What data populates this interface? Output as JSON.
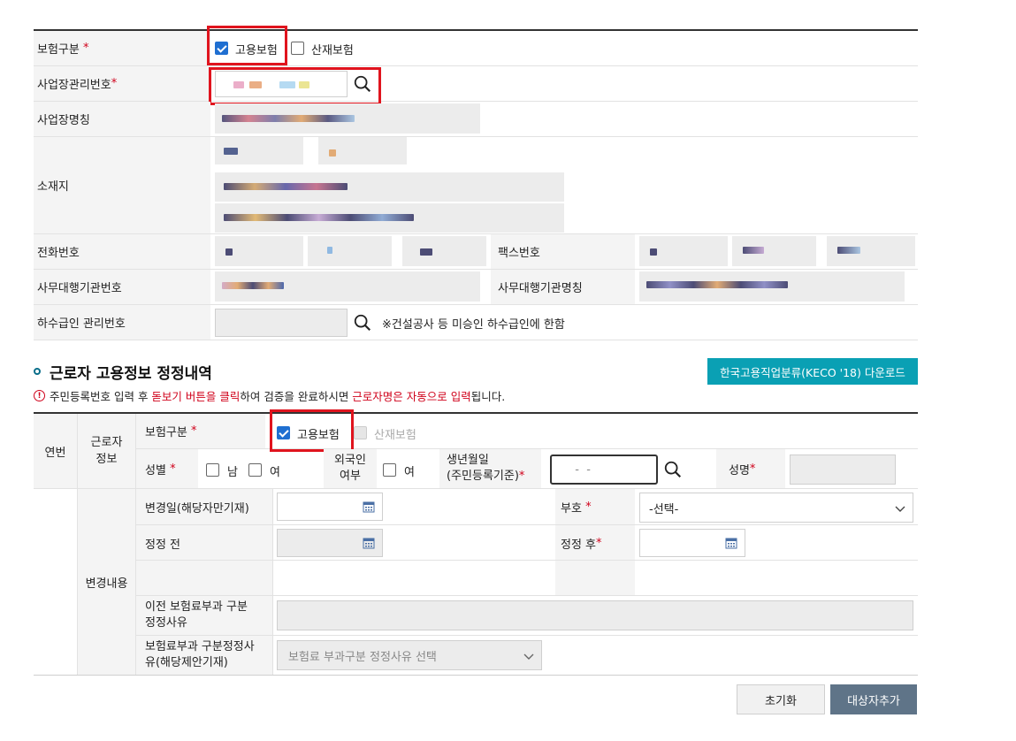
{
  "business": {
    "insurance_type_label": "보험구분",
    "insurance_options": [
      {
        "label": "고용보험",
        "checked": true
      },
      {
        "label": "산재보험",
        "checked": false
      }
    ],
    "business_no_label": "사업장관리번호",
    "business_name_label": "사업장명칭",
    "location_label": "소재지",
    "phone_label": "전화번호",
    "fax_label": "팩스번호",
    "agent_no_label": "사무대행기관번호",
    "agent_name_label": "사무대행기관명칭",
    "subcontract_label": "하수급인 관리번호",
    "subcontract_note": "※건설공사 등 미승인 하수급인에 한함",
    "required_mark": "*"
  },
  "section": {
    "title": "근로자 고용정보 정정내역",
    "download_button": "한국고용직업분류(KECO '18) 다운로드",
    "notice_parts": [
      {
        "text": "주민등록번호 입력 후 ",
        "red": false
      },
      {
        "text": "돋보기 버튼을 클릭",
        "red": true
      },
      {
        "text": "하여 검증을 완료하시면 ",
        "red": false
      },
      {
        "text": "근로자명은 자동으로 입력",
        "red": true
      },
      {
        "text": "됩니다.",
        "red": false
      }
    ]
  },
  "worker": {
    "seq_label": "연번",
    "info_label_1": "근로자",
    "info_label_2": "정보",
    "insurance_type_label": "보험구분",
    "insurance_options": [
      {
        "label": "고용보험",
        "checked": true
      },
      {
        "label": "산재보험",
        "checked": false,
        "disabled": true
      }
    ],
    "gender_label": "성별",
    "male": "남",
    "female": "여",
    "foreigner_label_1": "외국인",
    "foreigner_label_2": "여부",
    "foreigner_option": "여",
    "birth_label_1": "생년월일",
    "birth_label_2": "(주민등록기준)",
    "birth_value": "  -  -",
    "name_label": "성명"
  },
  "change": {
    "section_label": "변경내용",
    "change_date_label": "변경일(해당자만기재)",
    "code_label": "부호",
    "code_select": "-선택-",
    "before_label": "정정 전",
    "after_label": "정정 후",
    "prev_reason_label_1": "이전 보험료부과 구분",
    "prev_reason_label_2": "정정사유",
    "reason_label_1": "보험료부과 구분정정사",
    "reason_label_2": "유(해당제안기재)",
    "reason_select": "보험료 부과구분 정정사유 선택"
  },
  "buttons": {
    "reset": "초기화",
    "add": "대상자추가"
  },
  "colors": {
    "accent_teal": "#0aa0b4",
    "required_red": "#d0021b",
    "highlight_red": "#e0141e",
    "check_blue": "#1f6fd1",
    "button_slate": "#5f7488"
  }
}
